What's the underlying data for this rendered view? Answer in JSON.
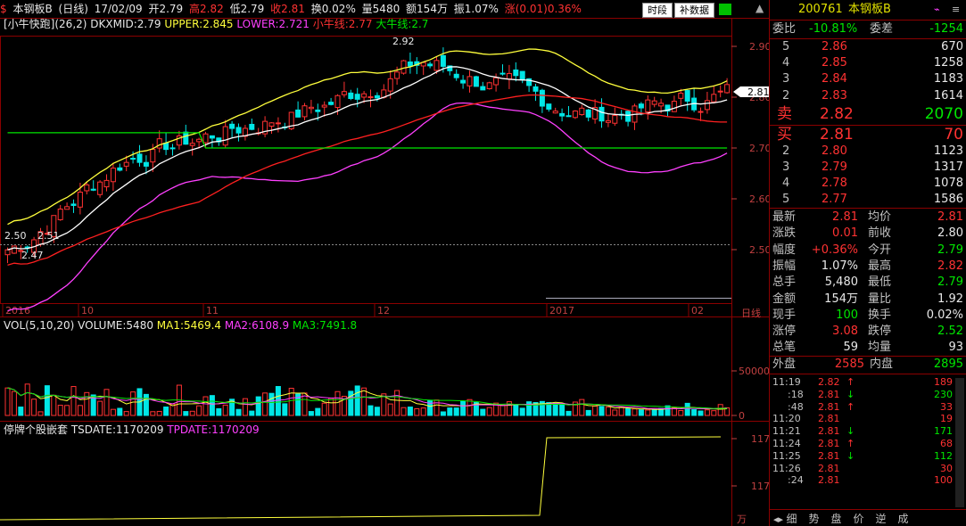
{
  "header": {
    "dollar_icon": "$",
    "name": "本钢板B",
    "period": "(日线)",
    "date": "17/02/09",
    "open": "开2.79",
    "high": "高2.82",
    "low": "低2.79",
    "close": "收2.81",
    "turnover": "换0.02%",
    "volume": "量5480",
    "amount": "额154万",
    "amplitude": "振1.07%",
    "change": "涨(0.01)0.36%",
    "btn_time": "时段",
    "btn_data": "补数据"
  },
  "main_legend": {
    "name": "[小牛快跑](26,2)",
    "dkxmid": "DKXMID:2.79",
    "upper": "UPPER:2.845",
    "lower": "LOWER:2.721",
    "small": "小牛线:2.77",
    "big": "大牛线:2.7"
  },
  "price_axis": [
    "2.90",
    "2.80",
    "2.70",
    "2.60",
    "2.50"
  ],
  "current_price_tag": "2.81",
  "annotations": {
    "high": "2.92",
    "low1": "2.50",
    "low2": "2.51",
    "low3": "2.47"
  },
  "time_axis": [
    "2016",
    "10",
    "11",
    "12",
    "2017",
    "02"
  ],
  "time_axis_label": "日线",
  "volume_legend": {
    "name": "VOL(5,10,20)",
    "volume": "VOLUME:5480",
    "ma1": "MA1:5469.4",
    "ma2": "MA2:6108.9",
    "ma3": "MA3:7491.8"
  },
  "volume_axis": [
    "50000",
    "0"
  ],
  "indicator_legend": {
    "name": "停牌个股嵌套",
    "tsdate": "TSDATE:1170209",
    "tpdate": "TPDATE:1170209"
  },
  "indicator_axis": [
    "117",
    "117"
  ],
  "indicator_axis_label": "万",
  "quote": {
    "code": "200761",
    "name": "本钢板B",
    "weibi_label": "委比",
    "weibi": "-10.81%",
    "weicha_label": "委差",
    "weicha": "-1254",
    "asks": [
      {
        "level": "5",
        "price": "2.86",
        "vol": "670"
      },
      {
        "level": "4",
        "price": "2.85",
        "vol": "1258"
      },
      {
        "level": "3",
        "price": "2.84",
        "vol": "1183"
      },
      {
        "level": "2",
        "price": "2.83",
        "vol": "1614"
      }
    ],
    "sell_label": "卖",
    "sell_price": "2.82",
    "sell_vol": "2070",
    "buy_label": "买",
    "buy_price": "2.81",
    "buy_vol": "70",
    "bids": [
      {
        "level": "2",
        "price": "2.80",
        "vol": "1123"
      },
      {
        "level": "3",
        "price": "2.79",
        "vol": "1317"
      },
      {
        "level": "4",
        "price": "2.78",
        "vol": "1078"
      },
      {
        "level": "5",
        "price": "2.77",
        "vol": "1586"
      }
    ],
    "stats": [
      {
        "l1": "最新",
        "v1": "2.81",
        "l2": "均价",
        "v2": "2.81"
      },
      {
        "l1": "涨跌",
        "v1": "0.01",
        "l2": "前收",
        "v2": "2.80"
      },
      {
        "l1": "幅度",
        "v1": "+0.36%",
        "l2": "今开",
        "v2": "2.79"
      },
      {
        "l1": "振幅",
        "v1": "1.07%",
        "l2": "最高",
        "v2": "2.82"
      },
      {
        "l1": "总手",
        "v1": "5,480",
        "l2": "最低",
        "v2": "2.79"
      },
      {
        "l1": "金额",
        "v1": "154万",
        "l2": "量比",
        "v2": "1.92"
      },
      {
        "l1": "现手",
        "v1": "100",
        "l2": "换手",
        "v2": "0.02%"
      },
      {
        "l1": "涨停",
        "v1": "3.08",
        "l2": "跌停",
        "v2": "2.52"
      },
      {
        "l1": "总笔",
        "v1": "59",
        "l2": "均量",
        "v2": "93"
      }
    ],
    "outer_label": "外盘",
    "outer": "2585",
    "inner_label": "内盘",
    "inner": "2895",
    "ticks": [
      {
        "time": "11:19",
        "price": "2.82",
        "dir": "↑",
        "vol": "189"
      },
      {
        "time": ":18",
        "price": "2.81",
        "dir": "↓",
        "vol": "230"
      },
      {
        "time": ":48",
        "price": "2.81",
        "dir": "↑",
        "vol": "33"
      },
      {
        "time": "11:20",
        "price": "2.81",
        "dir": "",
        "vol": "19"
      },
      {
        "time": "11:21",
        "price": "2.81",
        "dir": "↓",
        "vol": "171"
      },
      {
        "time": "11:24",
        "price": "2.81",
        "dir": "↑",
        "vol": "68"
      },
      {
        "time": "11:25",
        "price": "2.81",
        "dir": "↓",
        "vol": "112"
      },
      {
        "time": "11:26",
        "price": "2.81",
        "dir": "",
        "vol": "30"
      },
      {
        "time": ":24",
        "price": "2.81",
        "dir": "",
        "vol": "100"
      }
    ],
    "tabs": [
      "细",
      "势",
      "盘",
      "价",
      "逆",
      "成"
    ]
  },
  "colors": {
    "up": "#ff3232",
    "down": "#00e6e6",
    "upper": "#ffff3c",
    "lower": "#ff40ff",
    "small": "#ff2020",
    "big": "#00e600",
    "dkx": "#ffffff"
  }
}
